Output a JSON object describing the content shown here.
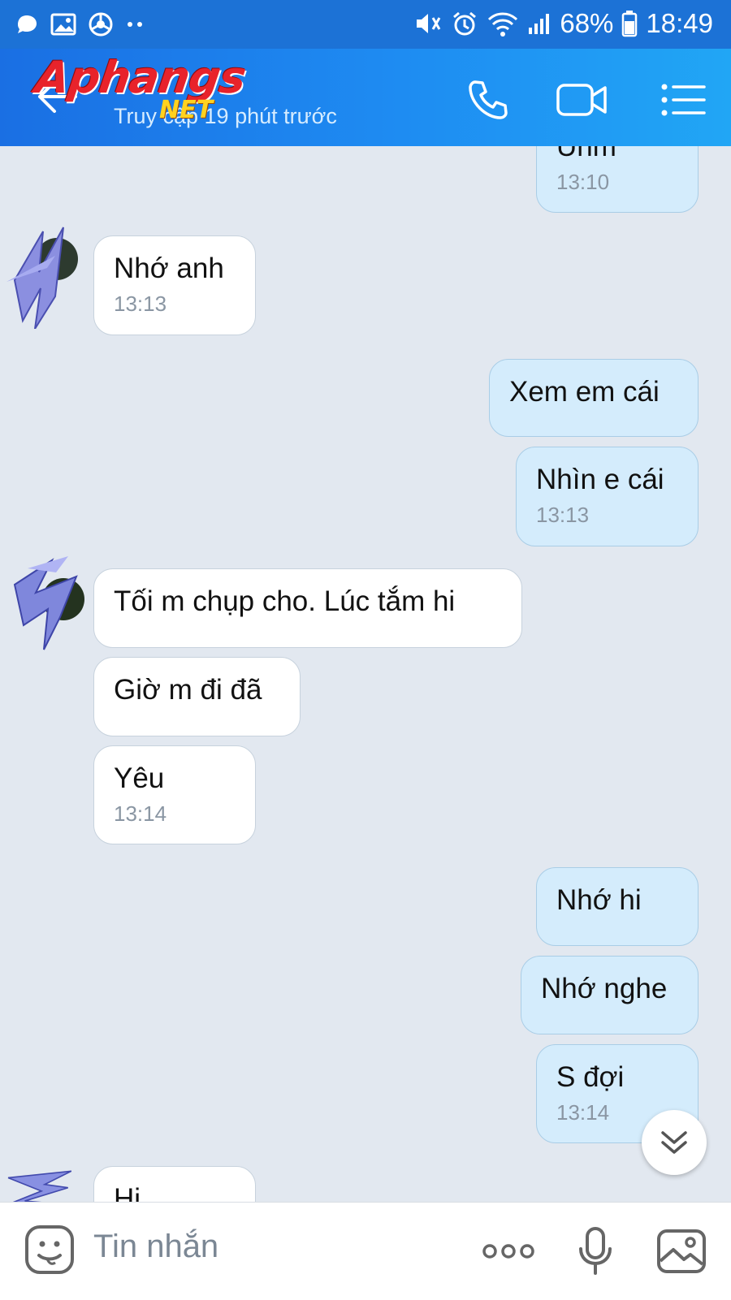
{
  "status_bar": {
    "battery": "68%",
    "time": "18:49"
  },
  "header": {
    "logo_text": "Aphangs",
    "logo_suffix": "NET",
    "subtitle": "Truy cập 19 phút trước"
  },
  "messages": [
    {
      "side": "out",
      "text": "Uhm",
      "time": "13:10"
    },
    {
      "side": "in",
      "text": "Nhớ anh",
      "time": "13:13"
    },
    {
      "side": "out",
      "text": "Xem em cái",
      "time": ""
    },
    {
      "side": "out",
      "text": "Nhìn e cái",
      "time": "13:13"
    },
    {
      "side": "in",
      "text": "Tối m chụp cho. Lúc tắm hi",
      "time": ""
    },
    {
      "side": "in",
      "text": "Giờ m đi đã",
      "time": ""
    },
    {
      "side": "in",
      "text": "Yêu",
      "time": "13:14"
    },
    {
      "side": "out",
      "text": "Nhớ hi",
      "time": ""
    },
    {
      "side": "out",
      "text": "Nhớ nghe",
      "time": ""
    },
    {
      "side": "out",
      "text": "S đợi",
      "time": "13:14"
    },
    {
      "side": "in",
      "text": "Hi",
      "time": ""
    }
  ],
  "composer": {
    "placeholder": "Tin nhắn"
  },
  "icons": [
    "back-arrow-icon",
    "phone-icon",
    "video-call-icon",
    "menu-list-icon",
    "chevron-double-down-icon",
    "sticker-icon",
    "more-dots-icon",
    "microphone-icon",
    "image-icon"
  ],
  "colors": {
    "header_start": "#1a6fe3",
    "header_end": "#21a6f5",
    "incoming_bubble": "#ffffff",
    "outgoing_bubble": "#d4ecfc",
    "chat_background": "#e2e8f0"
  }
}
